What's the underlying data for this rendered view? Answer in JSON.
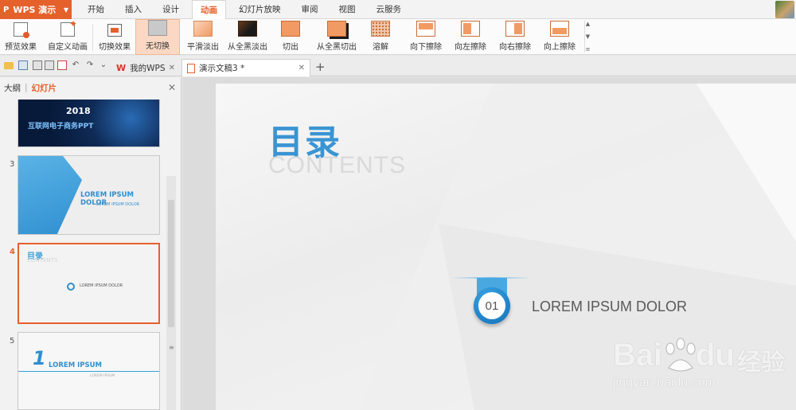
{
  "app": {
    "name": "WPS 演示",
    "menu_tabs": [
      "开始",
      "插入",
      "设计",
      "动画",
      "幻灯片放映",
      "审阅",
      "视图",
      "云服务"
    ],
    "active_tab": "动画"
  },
  "ribbon": {
    "items": [
      {
        "label": "预览效果",
        "icon": "preview-icon"
      },
      {
        "label": "自定义动画",
        "icon": "custom-animation-icon"
      },
      {
        "label": "切换效果",
        "icon": "transition-icon"
      },
      {
        "label": "无切换",
        "icon": "no-transition-icon",
        "selected": true
      },
      {
        "label": "平滑淡出",
        "icon": "fade-icon"
      },
      {
        "label": "从全黑淡出",
        "icon": "fade-black-icon"
      },
      {
        "label": "切出",
        "icon": "cut-icon"
      },
      {
        "label": "从全黑切出",
        "icon": "cut-black-icon"
      },
      {
        "label": "溶解",
        "icon": "dissolve-icon"
      },
      {
        "label": "向下擦除",
        "icon": "wipe-down-icon"
      },
      {
        "label": "向左擦除",
        "icon": "wipe-left-icon"
      },
      {
        "label": "向右擦除",
        "icon": "wipe-right-icon"
      },
      {
        "label": "向上擦除",
        "icon": "wipe-up-icon"
      }
    ]
  },
  "doc_tabs": [
    {
      "label": "我的WPS",
      "active": false
    },
    {
      "label": "演示文稿3 *",
      "active": true
    }
  ],
  "panel": {
    "tab_outline": "大纲",
    "tab_slides": "幻灯片",
    "slides": [
      {
        "num": "",
        "year": "2018",
        "subtitle": "互联网电子商务PPT"
      },
      {
        "num": "3",
        "title": "LOREM IPSUM DOLOR",
        "subtitle": "LOREM IPSUM DOLOR"
      },
      {
        "num": "4",
        "title": "目录",
        "ghost": "CONTENTS",
        "item_text": "LOREM IPSUM DOLOR",
        "active": true
      },
      {
        "num": "5",
        "big": "1",
        "title": "LOREM IPSUM",
        "subtitle": "LOREM IPSUM"
      }
    ]
  },
  "slide": {
    "title_cn": "目录",
    "title_en": "CONTENTS",
    "item_number": "01",
    "item_text": "LOREM IPSUM DOLOR"
  },
  "watermark": {
    "brand": "Bai",
    "brand2": "du",
    "cn": "经验",
    "url": "jingyan.baidu.com"
  },
  "colors": {
    "accent": "#e4612c",
    "slide_blue": "#3a94d2",
    "badge_blue": "#136fb6"
  }
}
